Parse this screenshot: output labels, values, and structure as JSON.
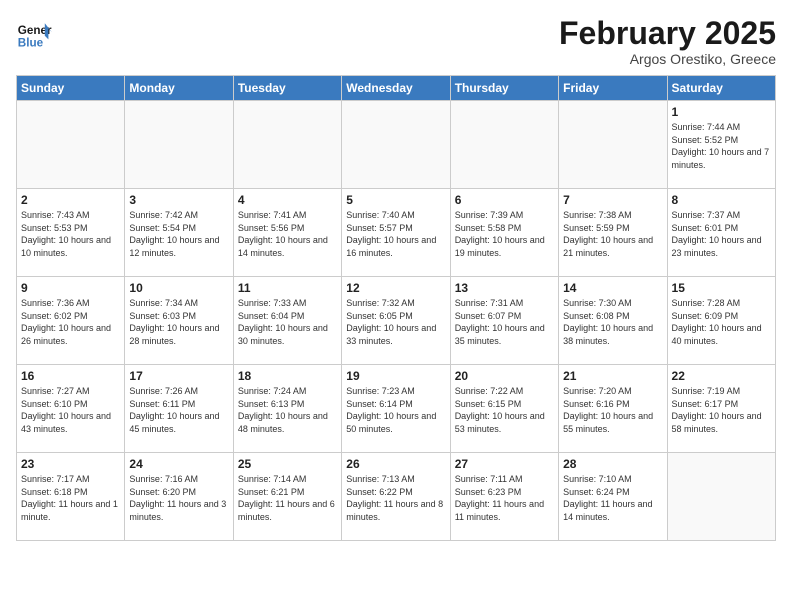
{
  "header": {
    "logo_line1": "General",
    "logo_line2": "Blue",
    "month_title": "February 2025",
    "subtitle": "Argos Orestiko, Greece"
  },
  "days_of_week": [
    "Sunday",
    "Monday",
    "Tuesday",
    "Wednesday",
    "Thursday",
    "Friday",
    "Saturday"
  ],
  "weeks": [
    [
      {
        "num": "",
        "empty": true
      },
      {
        "num": "",
        "empty": true
      },
      {
        "num": "",
        "empty": true
      },
      {
        "num": "",
        "empty": true
      },
      {
        "num": "",
        "empty": true
      },
      {
        "num": "",
        "empty": true
      },
      {
        "num": "1",
        "sunrise": "7:44 AM",
        "sunset": "5:52 PM",
        "daylight": "Daylight: 10 hours and 7 minutes."
      }
    ],
    [
      {
        "num": "2",
        "sunrise": "7:43 AM",
        "sunset": "5:53 PM",
        "daylight": "Daylight: 10 hours and 10 minutes."
      },
      {
        "num": "3",
        "sunrise": "7:42 AM",
        "sunset": "5:54 PM",
        "daylight": "Daylight: 10 hours and 12 minutes."
      },
      {
        "num": "4",
        "sunrise": "7:41 AM",
        "sunset": "5:56 PM",
        "daylight": "Daylight: 10 hours and 14 minutes."
      },
      {
        "num": "5",
        "sunrise": "7:40 AM",
        "sunset": "5:57 PM",
        "daylight": "Daylight: 10 hours and 16 minutes."
      },
      {
        "num": "6",
        "sunrise": "7:39 AM",
        "sunset": "5:58 PM",
        "daylight": "Daylight: 10 hours and 19 minutes."
      },
      {
        "num": "7",
        "sunrise": "7:38 AM",
        "sunset": "5:59 PM",
        "daylight": "Daylight: 10 hours and 21 minutes."
      },
      {
        "num": "8",
        "sunrise": "7:37 AM",
        "sunset": "6:01 PM",
        "daylight": "Daylight: 10 hours and 23 minutes."
      }
    ],
    [
      {
        "num": "9",
        "sunrise": "7:36 AM",
        "sunset": "6:02 PM",
        "daylight": "Daylight: 10 hours and 26 minutes."
      },
      {
        "num": "10",
        "sunrise": "7:34 AM",
        "sunset": "6:03 PM",
        "daylight": "Daylight: 10 hours and 28 minutes."
      },
      {
        "num": "11",
        "sunrise": "7:33 AM",
        "sunset": "6:04 PM",
        "daylight": "Daylight: 10 hours and 30 minutes."
      },
      {
        "num": "12",
        "sunrise": "7:32 AM",
        "sunset": "6:05 PM",
        "daylight": "Daylight: 10 hours and 33 minutes."
      },
      {
        "num": "13",
        "sunrise": "7:31 AM",
        "sunset": "6:07 PM",
        "daylight": "Daylight: 10 hours and 35 minutes."
      },
      {
        "num": "14",
        "sunrise": "7:30 AM",
        "sunset": "6:08 PM",
        "daylight": "Daylight: 10 hours and 38 minutes."
      },
      {
        "num": "15",
        "sunrise": "7:28 AM",
        "sunset": "6:09 PM",
        "daylight": "Daylight: 10 hours and 40 minutes."
      }
    ],
    [
      {
        "num": "16",
        "sunrise": "7:27 AM",
        "sunset": "6:10 PM",
        "daylight": "Daylight: 10 hours and 43 minutes."
      },
      {
        "num": "17",
        "sunrise": "7:26 AM",
        "sunset": "6:11 PM",
        "daylight": "Daylight: 10 hours and 45 minutes."
      },
      {
        "num": "18",
        "sunrise": "7:24 AM",
        "sunset": "6:13 PM",
        "daylight": "Daylight: 10 hours and 48 minutes."
      },
      {
        "num": "19",
        "sunrise": "7:23 AM",
        "sunset": "6:14 PM",
        "daylight": "Daylight: 10 hours and 50 minutes."
      },
      {
        "num": "20",
        "sunrise": "7:22 AM",
        "sunset": "6:15 PM",
        "daylight": "Daylight: 10 hours and 53 minutes."
      },
      {
        "num": "21",
        "sunrise": "7:20 AM",
        "sunset": "6:16 PM",
        "daylight": "Daylight: 10 hours and 55 minutes."
      },
      {
        "num": "22",
        "sunrise": "7:19 AM",
        "sunset": "6:17 PM",
        "daylight": "Daylight: 10 hours and 58 minutes."
      }
    ],
    [
      {
        "num": "23",
        "sunrise": "7:17 AM",
        "sunset": "6:18 PM",
        "daylight": "Daylight: 11 hours and 1 minute."
      },
      {
        "num": "24",
        "sunrise": "7:16 AM",
        "sunset": "6:20 PM",
        "daylight": "Daylight: 11 hours and 3 minutes."
      },
      {
        "num": "25",
        "sunrise": "7:14 AM",
        "sunset": "6:21 PM",
        "daylight": "Daylight: 11 hours and 6 minutes."
      },
      {
        "num": "26",
        "sunrise": "7:13 AM",
        "sunset": "6:22 PM",
        "daylight": "Daylight: 11 hours and 8 minutes."
      },
      {
        "num": "27",
        "sunrise": "7:11 AM",
        "sunset": "6:23 PM",
        "daylight": "Daylight: 11 hours and 11 minutes."
      },
      {
        "num": "28",
        "sunrise": "7:10 AM",
        "sunset": "6:24 PM",
        "daylight": "Daylight: 11 hours and 14 minutes."
      },
      {
        "num": "",
        "empty": true
      }
    ]
  ]
}
